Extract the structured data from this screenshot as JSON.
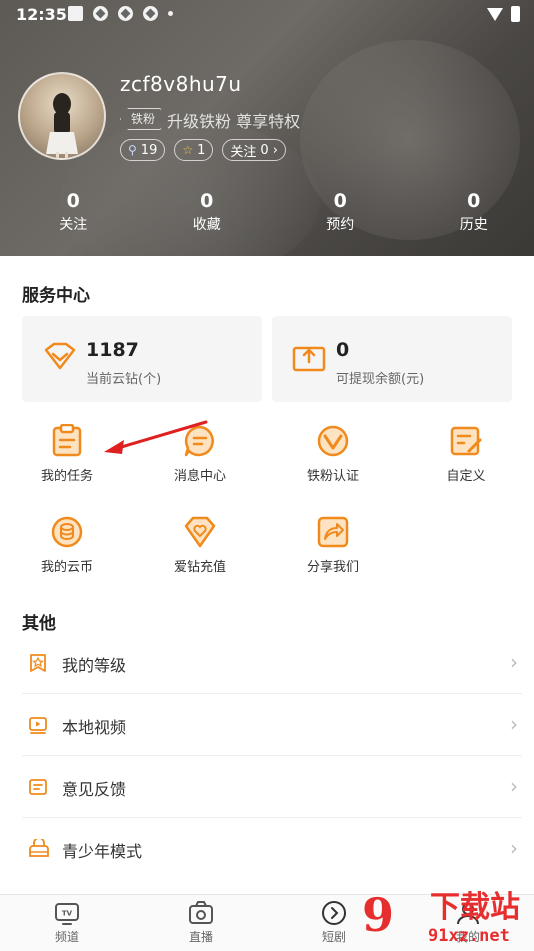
{
  "status_bar": {
    "time": "12:35"
  },
  "profile": {
    "username": "zcf8v8hu7u",
    "badge": "铁粉",
    "badge_text": "升级铁粉  尊享特权",
    "pills": [
      {
        "icon": "user-search-icon",
        "value": "19"
      },
      {
        "icon": "star-icon",
        "value": "1"
      },
      {
        "label": "关注",
        "value": "0"
      }
    ]
  },
  "stats": [
    {
      "value": "0",
      "label": "关注"
    },
    {
      "value": "0",
      "label": "收藏"
    },
    {
      "value": "0",
      "label": "预约"
    },
    {
      "value": "0",
      "label": "历史"
    }
  ],
  "service_center": {
    "title": "服务中心",
    "cards": [
      {
        "value": "1187",
        "label": "当前云钻(个)",
        "icon": "diamond-icon"
      },
      {
        "value": "0",
        "label": "可提现余额(元)",
        "icon": "withdraw-icon"
      }
    ],
    "grid": [
      {
        "label": "我的任务",
        "icon": "task-icon"
      },
      {
        "label": "消息中心",
        "icon": "message-icon"
      },
      {
        "label": "铁粉认证",
        "icon": "verify-icon"
      },
      {
        "label": "自定义",
        "icon": "edit-icon"
      },
      {
        "label": "我的云币",
        "icon": "coin-icon"
      },
      {
        "label": "爱钻充值",
        "icon": "heart-diamond-icon"
      },
      {
        "label": "分享我们",
        "icon": "share-icon"
      }
    ]
  },
  "others": {
    "title": "其他",
    "items": [
      {
        "label": "我的等级",
        "icon": "level-icon"
      },
      {
        "label": "本地视频",
        "icon": "local-video-icon"
      },
      {
        "label": "意见反馈",
        "icon": "feedback-icon"
      },
      {
        "label": "青少年模式",
        "icon": "teen-mode-icon"
      }
    ]
  },
  "tabbar": [
    {
      "label": "频道",
      "icon": "tv-icon"
    },
    {
      "label": "直播",
      "icon": "live-icon"
    },
    {
      "label": "短剧",
      "icon": "play-icon"
    },
    {
      "label": "我的",
      "icon": "profile-icon"
    }
  ],
  "watermark": {
    "mark": "9",
    "text": "下载站",
    "url": "91xz.net"
  },
  "colors": {
    "accent": "#f08a1c",
    "header": "#5d5a55",
    "watermark": "#e62e2e"
  }
}
